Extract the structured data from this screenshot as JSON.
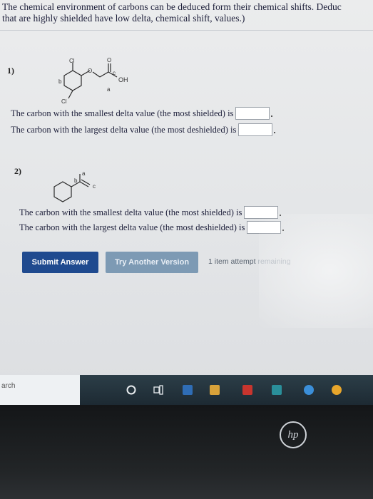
{
  "intro": {
    "line1": "The chemical environment of carbons can be deduced form their chemical shifts. Deduc",
    "line2": "that are highly shielded have low delta, chemical shift, values.)"
  },
  "questions": [
    {
      "number": "1)",
      "molecule_labels": {
        "cl_top": "Cl",
        "o_top": "O",
        "c": "c",
        "oh": "OH",
        "b": "b",
        "a": "a",
        "cl_bottom": "Cl"
      },
      "smallest_text": "The carbon with the smallest delta value (the most shielded) is",
      "largest_text": "The carbon with the largest delta value (the most deshielded) is",
      "smallest_value": "",
      "largest_value": ""
    },
    {
      "number": "2)",
      "molecule_labels": {
        "a": "a",
        "b": "b",
        "c": "c"
      },
      "smallest_text": "The carbon with the smallest delta value (the most shielded) is",
      "largest_text": "The carbon with the largest delta value (the most deshielded) is",
      "smallest_value": "",
      "largest_value": ""
    }
  ],
  "actions": {
    "submit_label": "Submit Answer",
    "try_label": "Try Another Version",
    "attempts_text": "1 item attempt",
    "attempts_fade": "remaining"
  },
  "taskbar": {
    "search_text": "arch",
    "accent_colors": [
      "#2f6db5",
      "#d8a23a",
      "#c8352e",
      "#2a8f9a",
      "#e8a62b"
    ]
  },
  "laptop": {
    "brand": "hp"
  }
}
